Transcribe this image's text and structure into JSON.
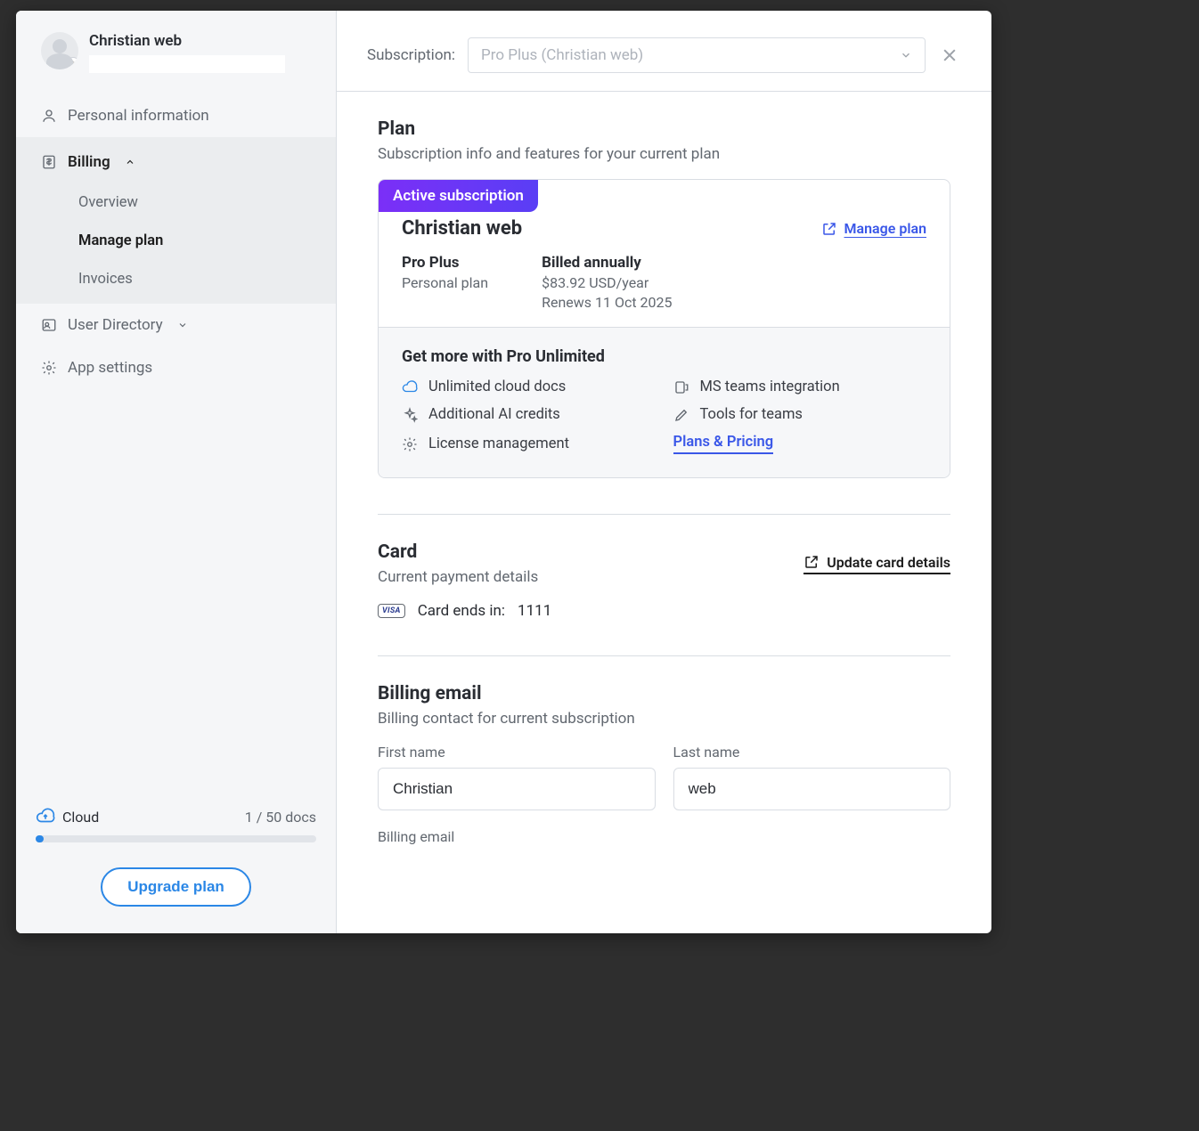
{
  "sidebar": {
    "user_name": "Christian web",
    "nav": {
      "personal": "Personal information",
      "billing": "Billing",
      "overview": "Overview",
      "manage_plan": "Manage plan",
      "invoices": "Invoices",
      "user_directory": "User Directory",
      "app_settings": "App settings"
    },
    "footer": {
      "cloud_label": "Cloud",
      "docs_count": "1 / 50 docs",
      "docs_used": 1,
      "docs_total": 50,
      "upgrade_label": "Upgrade plan"
    }
  },
  "topbar": {
    "label": "Subscription:",
    "selected": "Pro Plus (Christian web)"
  },
  "plan": {
    "title": "Plan",
    "subtitle": "Subscription info and features for your current plan",
    "badge": "Active subscription",
    "name": "Christian web",
    "manage_label": "Manage plan",
    "tier": "Pro Plus",
    "tier_sub": "Personal plan",
    "billing": "Billed annually",
    "price": "$83.92 USD/year",
    "renews": "Renews 11 Oct 2025"
  },
  "upsell": {
    "title": "Get more with Pro Unlimited",
    "features": {
      "f1": "Unlimited cloud docs",
      "f2": "MS teams integration",
      "f3": "Additional AI credits",
      "f4": "Tools for teams",
      "f5": "License management",
      "pricing": "Plans & Pricing"
    }
  },
  "card": {
    "title": "Card",
    "subtitle": "Current payment details",
    "update_label": "Update card details",
    "brand": "VISA",
    "ends_label": "Card ends in:",
    "last4": "1111"
  },
  "billing_email": {
    "title": "Billing email",
    "subtitle": "Billing contact for current subscription",
    "first_name_label": "First name",
    "last_name_label": "Last name",
    "first_name": "Christian",
    "last_name": "web",
    "email_label": "Billing email"
  }
}
